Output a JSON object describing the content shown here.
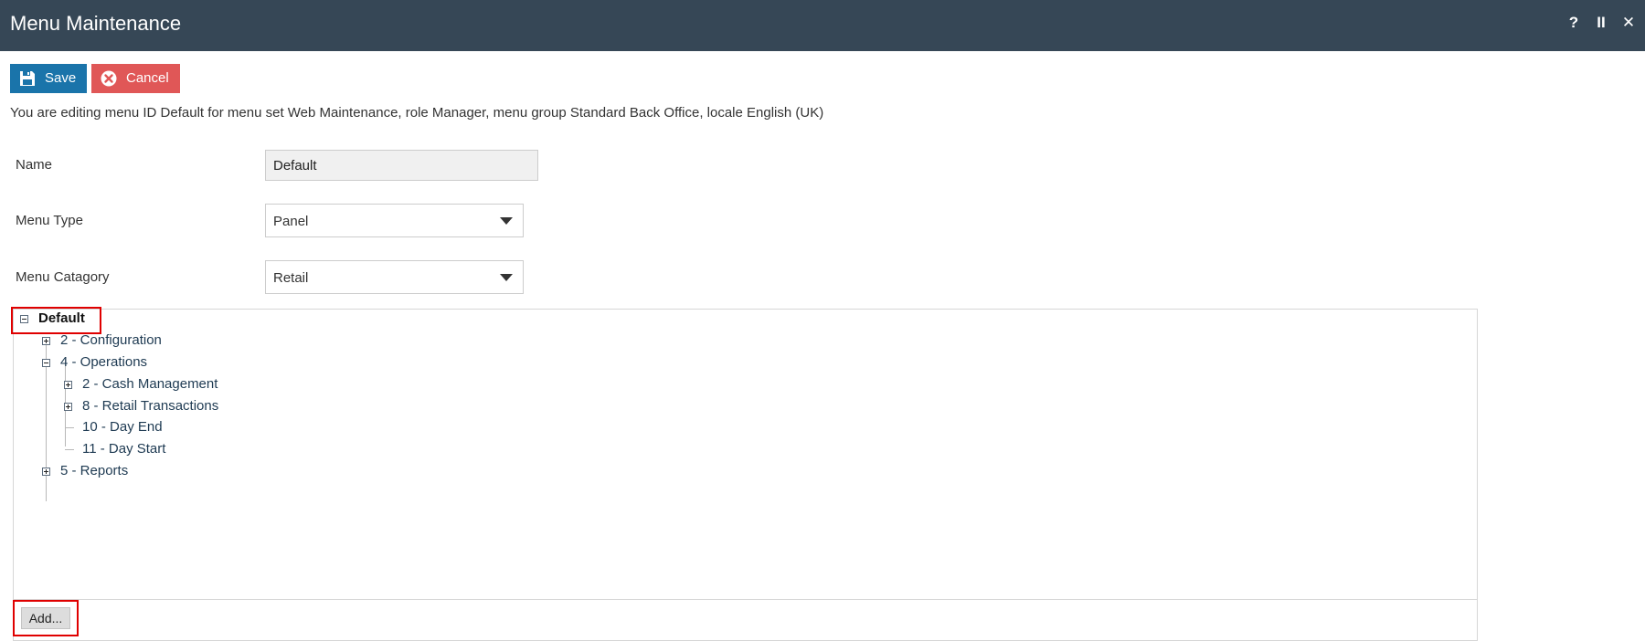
{
  "window": {
    "title": "Menu Maintenance",
    "controls": [
      {
        "name": "help-icon",
        "glyph": "?"
      },
      {
        "name": "pause-icon",
        "glyph": "II"
      },
      {
        "name": "close-icon",
        "glyph": "✕"
      }
    ]
  },
  "toolbar": {
    "save_label": "Save",
    "cancel_label": "Cancel",
    "save_color": "#1a74aa",
    "cancel_color": "#e05757"
  },
  "info_text": "You are editing menu ID Default for menu set Web Maintenance, role Manager, menu group Standard Back Office, locale English (UK)",
  "form": {
    "name_label": "Name",
    "name_value": "Default",
    "menu_type_label": "Menu Type",
    "menu_type_value": "Panel",
    "menu_category_label": "Menu Catagory",
    "menu_category_value": "Retail"
  },
  "tree": {
    "root": {
      "label": "Default",
      "expanded": true
    },
    "nodes": [
      {
        "label": "2 - Configuration",
        "expanded": false
      },
      {
        "label": "4 - Operations",
        "expanded": true
      },
      {
        "label": "2 - Cash Management",
        "expanded": false
      },
      {
        "label": "8 - Retail Transactions",
        "expanded": false
      },
      {
        "label": "10 - Day End"
      },
      {
        "label": "11 - Day Start"
      },
      {
        "label": "5 - Reports",
        "expanded": false
      }
    ]
  },
  "add_button_label": "Add...",
  "colors": {
    "titlebar": "#364756",
    "highlight": "#e00000"
  }
}
